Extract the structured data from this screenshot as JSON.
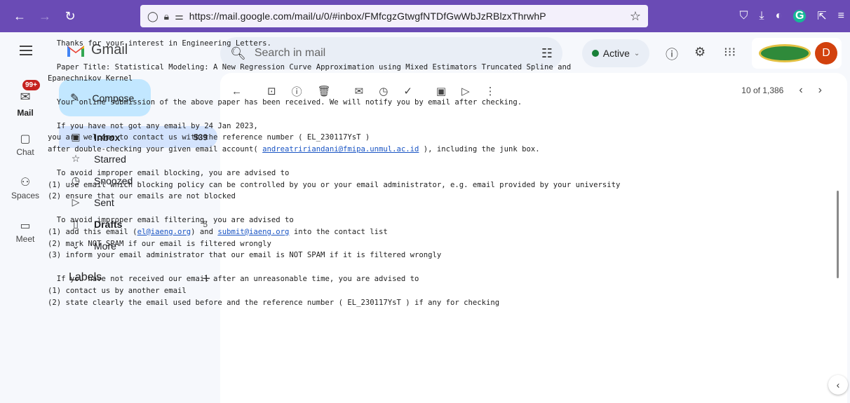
{
  "browser": {
    "url": "https://mail.google.com/mail/u/0/#inbox/FMfcgzGtwgfNTDfGwWbJzRBlzxThrwhP",
    "ext_g": "G",
    "accent": "#6a4bb5"
  },
  "header": {
    "app_name": "Gmail",
    "search_placeholder": "Search in mail",
    "status": "Active",
    "avatar_letter": "D"
  },
  "rail": {
    "mail_badge": "99+",
    "items": [
      {
        "label": "Mail"
      },
      {
        "label": "Chat"
      },
      {
        "label": "Spaces"
      },
      {
        "label": "Meet"
      }
    ]
  },
  "nav": {
    "compose": "Compose",
    "items": [
      {
        "label": "Inbox",
        "count": "539"
      },
      {
        "label": "Starred",
        "count": ""
      },
      {
        "label": "Snoozed",
        "count": ""
      },
      {
        "label": "Sent",
        "count": ""
      },
      {
        "label": "Drafts",
        "count": "5"
      },
      {
        "label": "More",
        "count": ""
      }
    ],
    "labels_heading": "Labels"
  },
  "toolbar": {
    "pager": "10 of 1,386"
  },
  "email": {
    "l1": "Thanks for your interest in Engineering Letters.",
    "l2": "Paper Title: Statistical Modeling: A New Regression Curve Approximation using Mixed Estimators Truncated Spline and",
    "l3": "Epanechnikov Kernel",
    "l4": "Your online submission of the above paper has been received. We will notify you by email after checking.",
    "l5": "If you have not got any email by 24 Jan 2023,",
    "l6": "you are welcome to contact us with the reference number ( EL_230117YsT )",
    "l7a": "after double-checking your given email account( ",
    "l7link": "andreatririandani@fmipa.unmul.ac.id",
    "l7b": " ), including the junk box.",
    "l8": "To avoid improper email blocking, you are advised to",
    "l9": "(1) use email which blocking policy can be controlled by you or your email administrator, e.g. email provided by your university",
    "l10": "(2) ensure that our emails are not blocked",
    "l11": "To avoid improper email filtering, you are advised to",
    "l12a": "(1) add this email (",
    "l12link1": "el@iaeng.org",
    "l12b": ") and ",
    "l12link2": "submit@iaeng.org",
    "l12c": " into the contact list",
    "l13": "(2) mark NOT SPAM if our email is filtered wrongly",
    "l14": "(3) inform your email administrator that our email is NOT SPAM if it is filtered wrongly",
    "l15": "If you have not received our email after an unreasonable time, you are advised to",
    "l16": "(1) contact us by another email",
    "l17": "(2) state clearly the email used before and the reference number ( EL_230117YsT ) if any for checking"
  }
}
